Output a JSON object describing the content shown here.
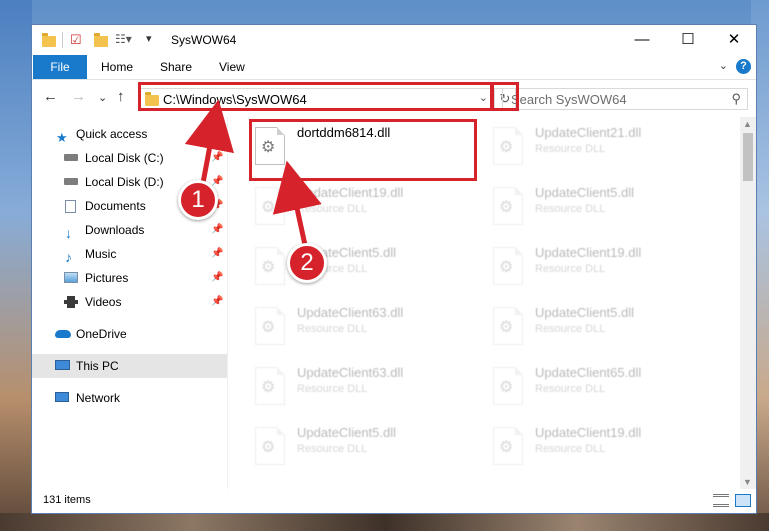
{
  "window": {
    "title": "SysWOW64",
    "minimize": "—",
    "maximize": "☐",
    "close": "✕"
  },
  "ribbon": {
    "file": "File",
    "home": "Home",
    "share": "Share",
    "view": "View",
    "help": "?"
  },
  "navbar": {
    "back": "←",
    "forward": "→",
    "recent": "⌄",
    "up": "↑",
    "address": "C:\\Windows\\SysWOW64",
    "refresh": "↻",
    "search_placeholder": "Search SysWOW64"
  },
  "sidebar": {
    "items": [
      {
        "label": "Quick access",
        "icon": "star-icon",
        "pinned": false
      },
      {
        "label": "Local Disk (C:)",
        "icon": "drive-icon",
        "pinned": true
      },
      {
        "label": "Local Disk (D:)",
        "icon": "drive-icon",
        "pinned": true
      },
      {
        "label": "Documents",
        "icon": "documents-icon",
        "pinned": true
      },
      {
        "label": "Downloads",
        "icon": "download-icon",
        "pinned": true
      },
      {
        "label": "Music",
        "icon": "music-icon",
        "pinned": true
      },
      {
        "label": "Pictures",
        "icon": "pictures-icon",
        "pinned": true
      },
      {
        "label": "Videos",
        "icon": "videos-icon",
        "pinned": true
      },
      {
        "label": "OneDrive",
        "icon": "cloud-icon",
        "pinned": false
      },
      {
        "label": "This PC",
        "icon": "computer-icon",
        "pinned": false,
        "selected": true
      },
      {
        "label": "Network",
        "icon": "network-icon",
        "pinned": false
      }
    ]
  },
  "files": [
    {
      "name": "dortddm6814.dll",
      "type": ""
    },
    {
      "name": "UpdateClient21.dll",
      "type": "Resource DLL"
    },
    {
      "name": "UpdateClient19.dll",
      "type": "Resource DLL"
    },
    {
      "name": "UpdateClient5.dll",
      "type": "Resource DLL"
    },
    {
      "name": "UpdateClient5.dll",
      "type": "Resource DLL"
    },
    {
      "name": "UpdateClient19.dll",
      "type": "Resource DLL"
    },
    {
      "name": "UpdateClient63.dll",
      "type": "Resource DLL"
    },
    {
      "name": "UpdateClient5.dll",
      "type": "Resource DLL"
    },
    {
      "name": "UpdateClient63.dll",
      "type": "Resource DLL"
    },
    {
      "name": "UpdateClient65.dll",
      "type": "Resource DLL"
    },
    {
      "name": "UpdateClient5.dll",
      "type": "Resource DLL"
    },
    {
      "name": "UpdateClient19.dll",
      "type": "Resource DLL"
    }
  ],
  "status": {
    "count": "131 items"
  },
  "callouts": {
    "one": "1",
    "two": "2"
  },
  "colors": {
    "accent": "#1979ca",
    "highlight": "#d6222a"
  }
}
